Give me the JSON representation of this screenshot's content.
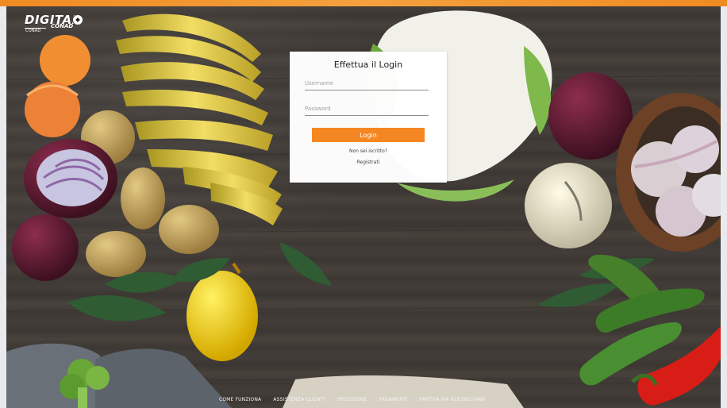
{
  "brand": {
    "main": "DIGITAL",
    "sub": "CONAD",
    "tiny": "CONAD"
  },
  "login": {
    "title": "Effettua il Login",
    "username_placeholder": "Username",
    "password_placeholder": "Password",
    "login_button": "Login",
    "not_registered": "Non sei iscritto?",
    "register_link": "Registrati"
  },
  "footer": {
    "links": [
      "COME FUNZIONA",
      "ASSISTENZA CLIENTI",
      "SPEDIZIONE",
      "PAGAMENTI"
    ],
    "vat": "PARTITA IVA 01939010466"
  },
  "colors": {
    "accent": "#f58722",
    "background": "#3f3a36",
    "card": "#ffffff"
  },
  "icons": {
    "logo_ball": "soccer-ball-icon"
  }
}
